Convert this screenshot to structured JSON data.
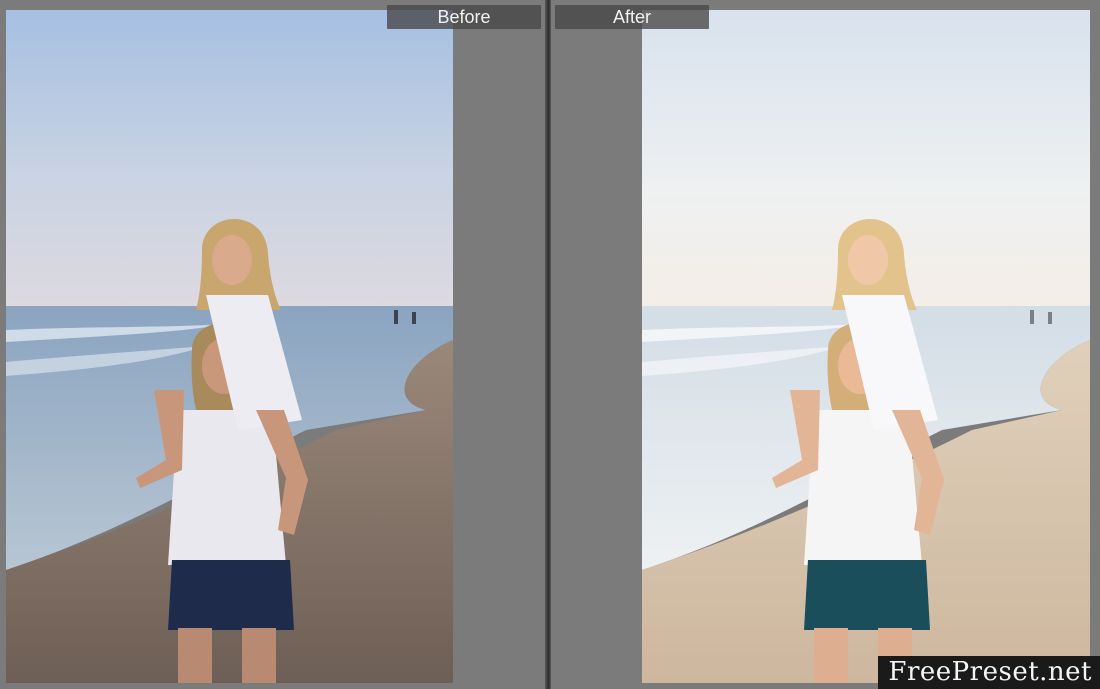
{
  "panes": {
    "before_label": "Before",
    "after_label": "After"
  },
  "photos": {
    "before": {
      "sky_top": "#a9c2e3",
      "sky_bottom": "#d9d7de",
      "sea": "#9fb3c8",
      "sand": "#8a7a6c",
      "skirt": "#1e2a4a"
    },
    "after": {
      "sky_top": "#d7e2ee",
      "sky_bottom": "#f3ede8",
      "sea": "#dfe6ec",
      "sand": "#d6c5ae",
      "skirt": "#1a4f5a"
    }
  },
  "watermark": {
    "text": "FreePreset.net"
  }
}
